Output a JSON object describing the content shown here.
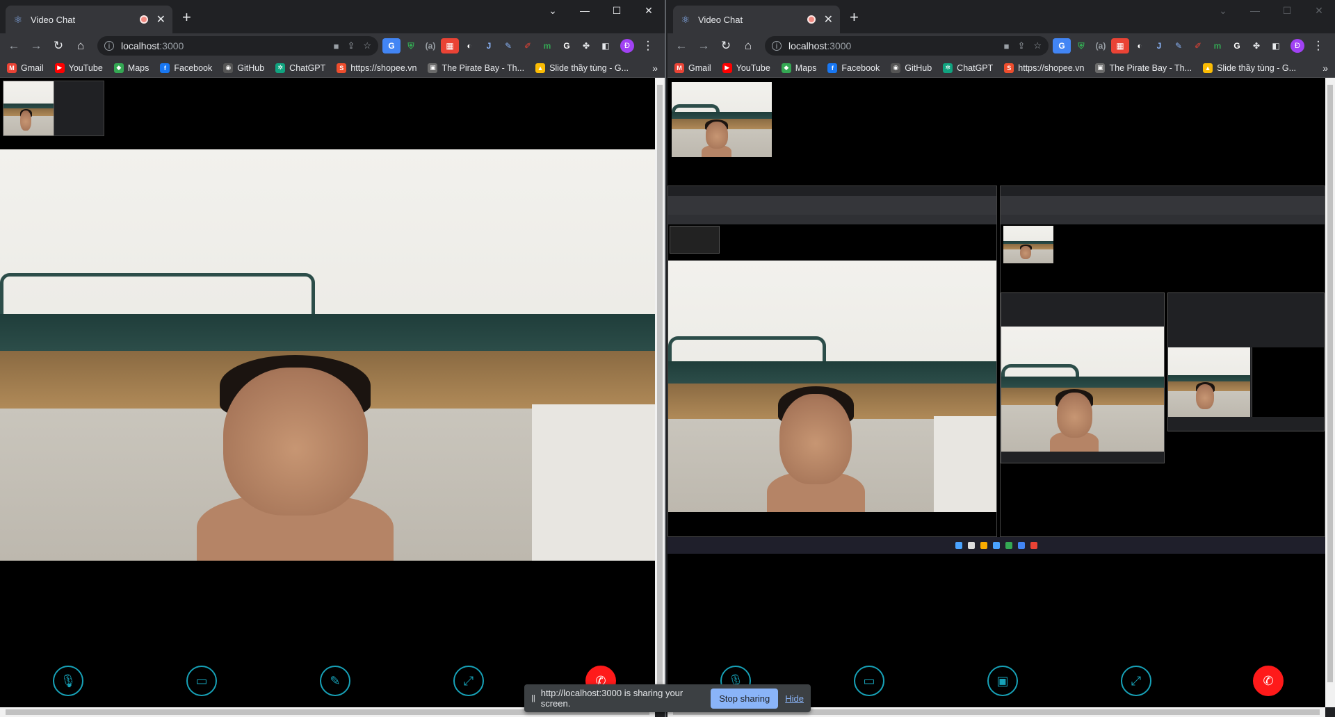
{
  "left_window": {
    "tab_title": "Video Chat",
    "url_host": "localhost",
    "url_port": ":3000"
  },
  "right_window": {
    "tab_title": "Video Chat",
    "url_host": "localhost",
    "url_port": ":3000"
  },
  "bookmarks": [
    {
      "label": "Gmail",
      "icon": "gmail-icon",
      "color": "#ea4335",
      "glyph": "M"
    },
    {
      "label": "YouTube",
      "icon": "youtube-icon",
      "color": "#ff0000",
      "glyph": "▶"
    },
    {
      "label": "Maps",
      "icon": "maps-icon",
      "color": "#34a853",
      "glyph": "◆"
    },
    {
      "label": "Facebook",
      "icon": "facebook-icon",
      "color": "#1877f2",
      "glyph": "f"
    },
    {
      "label": "GitHub",
      "icon": "github-icon",
      "color": "#555555",
      "glyph": "◉"
    },
    {
      "label": "ChatGPT",
      "icon": "chatgpt-icon",
      "color": "#10a37f",
      "glyph": "✲"
    },
    {
      "label": "https://shopee.vn",
      "icon": "shopee-icon",
      "color": "#ee4d2d",
      "glyph": "S"
    },
    {
      "label": "The Pirate Bay - Th...",
      "icon": "piratebay-icon",
      "color": "#6b6b6b",
      "glyph": "▣"
    },
    {
      "label": "Slide thầy tùng - G...",
      "icon": "google-slides-icon",
      "color": "#fbbc04",
      "glyph": "▲"
    }
  ],
  "profile_initial": "Đ",
  "controls": [
    {
      "name": "microphone-button",
      "glyph": "🎙"
    },
    {
      "name": "camera-button",
      "glyph": "▭"
    },
    {
      "name": "whiteboard-button",
      "glyph": "✎"
    },
    {
      "name": "fullscreen-button",
      "glyph": "⤢"
    },
    {
      "name": "hangup-button",
      "glyph": "✆"
    }
  ],
  "right_controls": [
    {
      "name": "microphone-button",
      "glyph": "🎙"
    },
    {
      "name": "camera-button",
      "glyph": "▭"
    },
    {
      "name": "screen-share-button",
      "glyph": "▣"
    },
    {
      "name": "fullscreen-button",
      "glyph": "⤢"
    },
    {
      "name": "hangup-button",
      "glyph": "✆"
    }
  ],
  "share_notification": {
    "message": "http://localhost:3000 is sharing your screen.",
    "stop_label": "Stop sharing",
    "hide_label": "Hide",
    "pause_glyph": "||"
  },
  "colors": {
    "accent": "#17a2b8",
    "hangup": "#ff1a1a",
    "chrome_dark": "#202124",
    "chrome_toolbar": "#35363a",
    "link_blue": "#8ab4f8"
  }
}
